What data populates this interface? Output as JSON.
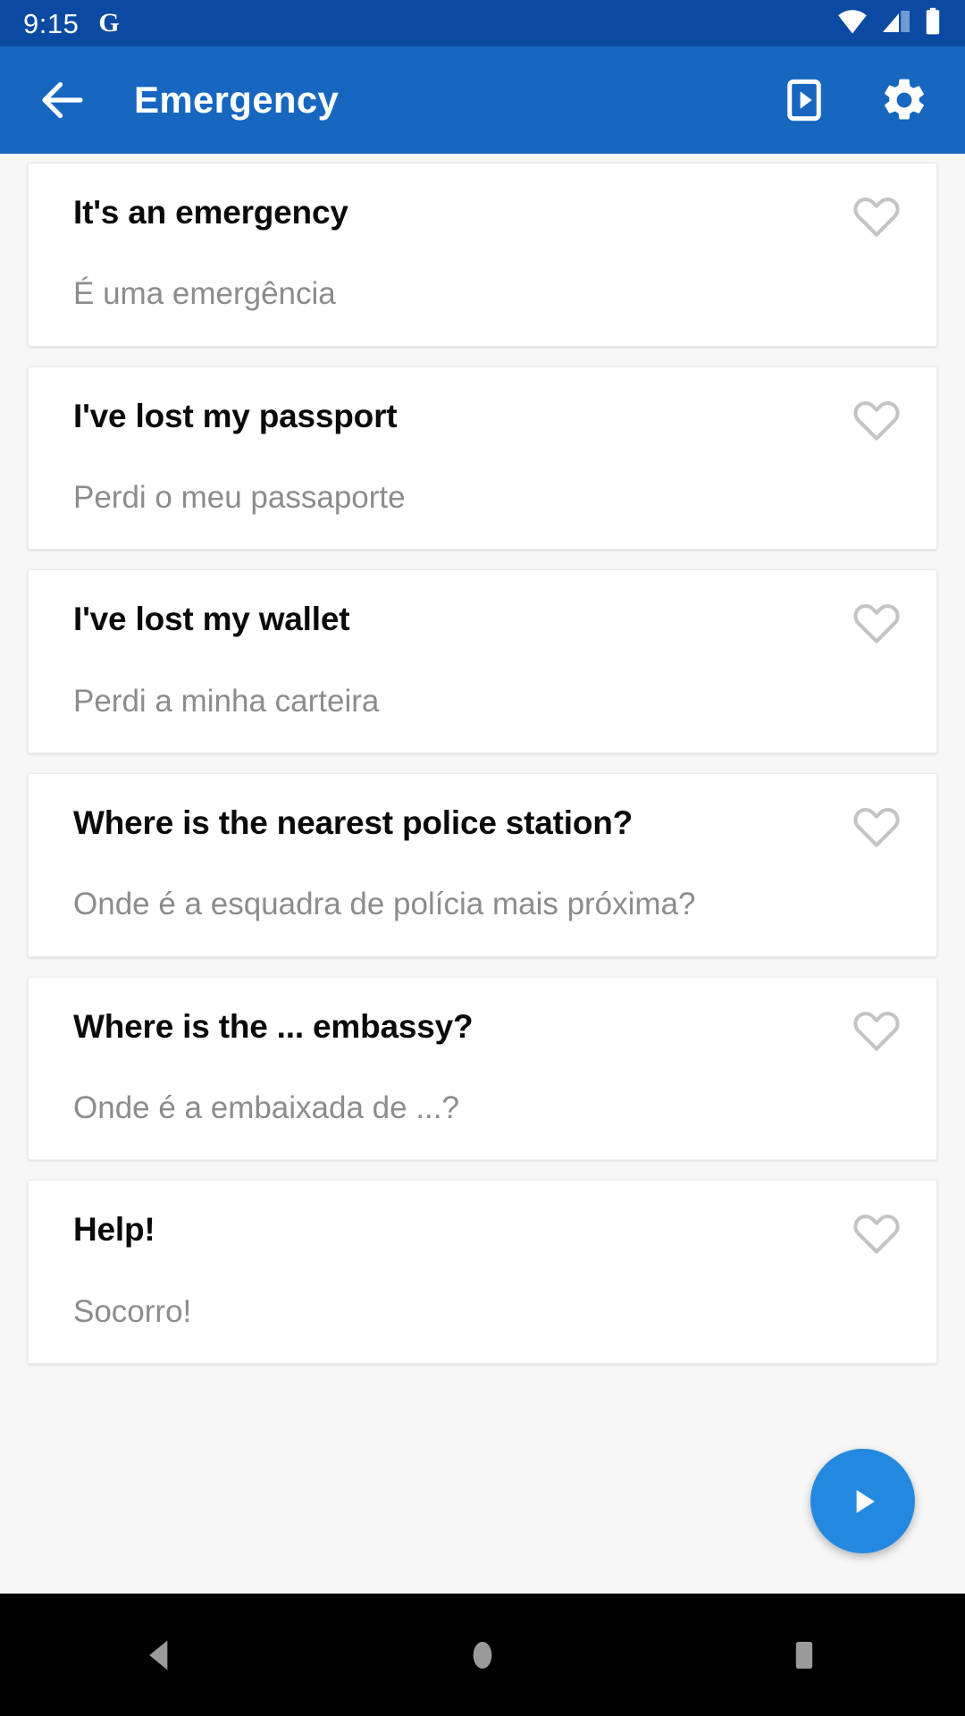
{
  "status_bar": {
    "time": "9:15",
    "brand_glyph": "G",
    "icons": [
      "wifi-icon",
      "cellular-signal-icon",
      "battery-icon"
    ]
  },
  "app_bar": {
    "title": "Emergency",
    "back_icon": "back-arrow-icon",
    "slideshow_icon": "slideshow-play-icon",
    "settings_icon": "gear-icon"
  },
  "colors": {
    "status_bar_bg": "#0b4aa2",
    "app_bar_bg": "#1766c0",
    "fab_bg": "#2389e0",
    "page_bg": "#f7f7f7",
    "card_bg": "#ffffff",
    "phrase_text": "#0a0a0a",
    "translation_text": "#8c8c8c",
    "heart_outline": "#c4c4c4",
    "nav_bar_bg": "#000000",
    "nav_icon": "#9a9a9a"
  },
  "phrases": [
    {
      "phrase": "It's an emergency",
      "translation": "É uma emergência",
      "favorite": false
    },
    {
      "phrase": "I've lost my passport",
      "translation": "Perdi o meu passaporte",
      "favorite": false
    },
    {
      "phrase": "I've lost my wallet",
      "translation": "Perdi a minha carteira",
      "favorite": false
    },
    {
      "phrase": "Where is the nearest police station?",
      "translation": "Onde é a esquadra de polícia mais próxima?",
      "favorite": false
    },
    {
      "phrase": "Where is the ... embassy?",
      "translation": "Onde é a embaixada de ...?",
      "favorite": false
    },
    {
      "phrase": "Help!",
      "translation": "Socorro!",
      "favorite": false
    }
  ],
  "fab": {
    "icon": "play-icon"
  },
  "nav_bar": {
    "back": "back-triangle-icon",
    "home": "home-circle-icon",
    "recents": "recents-square-icon"
  }
}
